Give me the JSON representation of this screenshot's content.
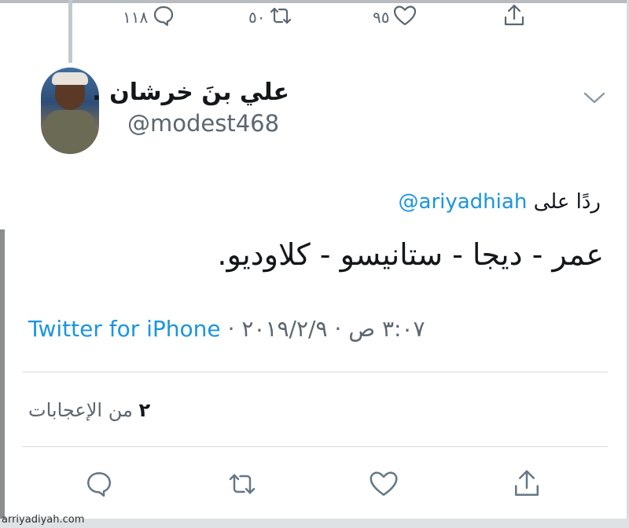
{
  "top_actions": {
    "reply_count": "١١٨",
    "retweet_count": "٥٠",
    "like_count": "٩٥",
    "reply_icon": "comment-icon",
    "retweet_icon": "retweet-icon",
    "like_icon": "heart-icon",
    "share_icon": "share-icon"
  },
  "tweet": {
    "display_name": "علي بنَ خرشان .",
    "handle": "@modest468",
    "replying_prefix": "ردًا على",
    "replying_to": "@ariyadhiah",
    "text": "عمر - ديجا - ستانيسو - كلاوديو.",
    "time": "٣:٠٧ ص",
    "date": "٢٠١٩/٢/٩",
    "separator": "·",
    "client": "Twitter for iPhone",
    "likes_count": "٢",
    "likes_label": "من الإعجابات"
  },
  "colors": {
    "link": "#1b95e0",
    "text": "#14171a",
    "muted": "#5b6670"
  },
  "watermark": "arriyadiyah.com"
}
